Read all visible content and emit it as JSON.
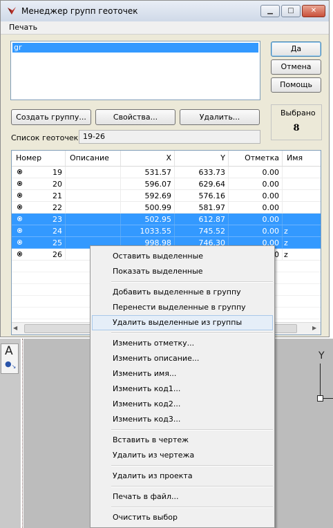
{
  "window": {
    "title": "Менеджер групп геоточек"
  },
  "menubar": {
    "items": [
      "Печать"
    ]
  },
  "groups": {
    "items": [
      "gr"
    ]
  },
  "buttons": {
    "ok": "Да",
    "cancel": "Отмена",
    "help": "Помощь",
    "create_group": "Создать группу...",
    "properties": "Свойства...",
    "delete": "Удалить..."
  },
  "selected": {
    "label": "Выбрано",
    "count": "8"
  },
  "points": {
    "label": "Список геоточек:",
    "value": "19-26"
  },
  "table": {
    "columns": [
      "Номер",
      "Описание",
      "X",
      "Y",
      "Отметка",
      "Имя"
    ],
    "rows": [
      {
        "num": "19",
        "desc": "",
        "x": "531.57",
        "y": "633.73",
        "elev": "0.00",
        "name": "",
        "selected": false
      },
      {
        "num": "20",
        "desc": "",
        "x": "596.07",
        "y": "629.64",
        "elev": "0.00",
        "name": "",
        "selected": false
      },
      {
        "num": "21",
        "desc": "",
        "x": "592.69",
        "y": "576.16",
        "elev": "0.00",
        "name": "",
        "selected": false
      },
      {
        "num": "22",
        "desc": "",
        "x": "500.99",
        "y": "581.97",
        "elev": "0.00",
        "name": "",
        "selected": false
      },
      {
        "num": "23",
        "desc": "",
        "x": "502.95",
        "y": "612.87",
        "elev": "0.00",
        "name": "",
        "selected": true
      },
      {
        "num": "24",
        "desc": "",
        "x": "1033.55",
        "y": "745.52",
        "elev": "0.00",
        "name": "z",
        "selected": true
      },
      {
        "num": "25",
        "desc": "",
        "x": "998.98",
        "y": "746.30",
        "elev": "0.00",
        "name": "z",
        "selected": true
      },
      {
        "num": "26",
        "desc": "",
        "x": "",
        "y": "",
        "elev": "0",
        "name": "z",
        "selected": false
      }
    ]
  },
  "context_menu": {
    "items": [
      "Оставить выделенные",
      "Показать выделенные",
      "Добавить выделенные в группу",
      "Перенести выделенные в группу",
      "Удалить выделенные из группы",
      "Изменить отметку...",
      "Изменить описание...",
      "Изменить имя...",
      "Изменить код1...",
      "Изменить код2...",
      "Изменить код3...",
      "Вставить в чертеж",
      "Удалить из чертежа",
      "Удалить из проекта",
      "Печать в файл...",
      "Очистить выбор"
    ],
    "highlighted_index": 4
  },
  "canvas": {
    "axis_label": "Y",
    "tool_label": "A"
  },
  "colors": {
    "selection": "#3399ff",
    "window_bg": "#ece9d8",
    "close_button": "#c9503a"
  }
}
